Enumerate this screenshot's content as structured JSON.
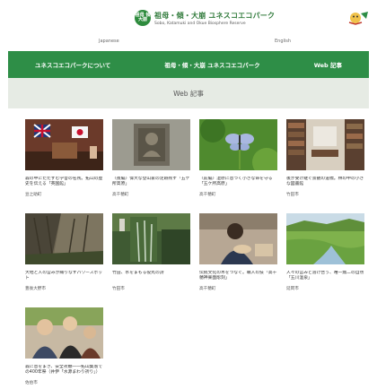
{
  "header": {
    "logo_badge": "祖母 傾 大崩",
    "logo_main": "祖母・傾・大崩 ユネスコエコパーク",
    "logo_sub": "Sobo, Katamuki and Okue Biosphere Reserve"
  },
  "lang": {
    "ja": "Japanese",
    "en": "English"
  },
  "nav": [
    {
      "label": "ユネスコエコパークについて"
    },
    {
      "label": "祖母・傾・大崩 ユネスコエコパーク"
    },
    {
      "label": "Web 記事"
    }
  ],
  "page_title": "Web 記事",
  "articles": [
    {
      "title": "森の中にたたずむ学舎の名残。拓山の歴史を伝える「英国館」",
      "author": "豆之助町"
    },
    {
      "title": "〈後編〉偉大な登山家の足跡残す「五ケ所高原」",
      "author": "高千穂町"
    },
    {
      "title": "〈前編〉湿原に息づく小さな命を守る「五ケ所高原」",
      "author": "高千穂町"
    },
    {
      "title": "後が受け継ぐ景観の道標。林の中の小さな図書館",
      "author": "竹田市"
    },
    {
      "title": "大地と人の営みが織りなすパワースポット",
      "author": "豊後大野市"
    },
    {
      "title": "竹田、水をまもる役丸の詩",
      "author": "竹田市"
    },
    {
      "title": "伝統文化の木をつなぐ。職人の技「高千穂神楽面彫刻」",
      "author": "高千穂町"
    },
    {
      "title": "人々の営みと溶け合う、唯一無二の自然「五川温泉」",
      "author": "延岡市"
    },
    {
      "title": "森に息をまき、安全祈願――拓山集落での400年祭（井伊「水源まわり祈り」）",
      "author": "佐伯市"
    }
  ]
}
